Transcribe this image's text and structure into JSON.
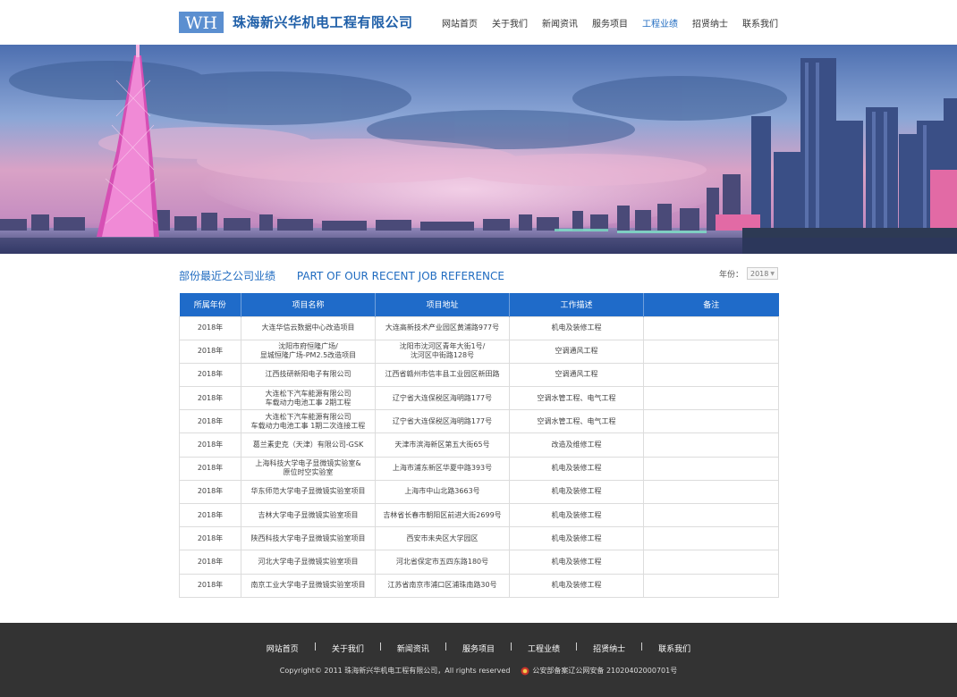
{
  "header": {
    "logo_text": "WH",
    "company_name": "珠海新兴华机电工程有限公司",
    "nav": [
      "网站首页",
      "关于我们",
      "新闻资讯",
      "服务项目",
      "工程业绩",
      "招贤纳士",
      "联系我们"
    ],
    "active_nav": "工程业绩"
  },
  "section": {
    "title_cn": "部份最近之公司业绩",
    "title_en": "PART OF OUR RECENT JOB REFERENCE",
    "year_label": "年份：",
    "year_value": "2018"
  },
  "table": {
    "headers": [
      "所属年份",
      "项目名称",
      "项目地址",
      "工作描述",
      "备注"
    ],
    "rows": [
      [
        "2018年",
        "大连华信云数据中心改造项目",
        "大连高新技术产业园区黄浦路977号",
        "机电及装修工程",
        ""
      ],
      [
        "2018年",
        "沈阳市府恒隆广场/\n显城恒隆广场-PM2.5改造项目",
        "沈阳市沈河区青年大街1号/\n沈河区中街路128号",
        "空调通风工程",
        ""
      ],
      [
        "2018年",
        "江西技研新阳电子有限公司",
        "江西省赣州市信丰县工业园区新田路",
        "空调通风工程",
        ""
      ],
      [
        "2018年",
        "大连松下汽车能源有限公司\n车载动力电池工事 2期工程",
        "辽宁省大连保税区海明路177号",
        "空调水管工程、电气工程",
        ""
      ],
      [
        "2018年",
        "大连松下汽车能源有限公司\n车载动力电池工事 1期二次连接工程",
        "辽宁省大连保税区海明路177号",
        "空调水管工程、电气工程",
        ""
      ],
      [
        "2018年",
        "葛兰素史克（天津）有限公司-GSK",
        "天津市滨海新区第五大街65号",
        "改造及维修工程",
        ""
      ],
      [
        "2018年",
        "上海科技大学电子显微镜实验室&\n原位时空实验室",
        "上海市浦东新区华夏中路393号",
        "机电及装修工程",
        ""
      ],
      [
        "2018年",
        "华东师范大学电子显微镜实验室项目",
        "上海市中山北路3663号",
        "机电及装修工程",
        ""
      ],
      [
        "2018年",
        "吉林大学电子显微镜实验室项目",
        "吉林省长春市朝阳区前进大街2699号",
        "机电及装修工程",
        ""
      ],
      [
        "2018年",
        "陕西科技大学电子显微镜实验室项目",
        "西安市未央区大学园区",
        "机电及装修工程",
        ""
      ],
      [
        "2018年",
        "河北大学电子显微镜实验室项目",
        "河北省保定市五四东路180号",
        "机电及装修工程",
        ""
      ],
      [
        "2018年",
        "南京工业大学电子显微镜实验室项目",
        "江苏省南京市浦口区浦珠南路30号",
        "机电及装修工程",
        ""
      ]
    ]
  },
  "footer": {
    "nav": [
      "网站首页",
      "关于我们",
      "新闻资讯",
      "服务项目",
      "工程业绩",
      "招贤纳士",
      "联系我们"
    ],
    "separator": "|",
    "copyright": "Copyright© 2011 珠海新兴华机电工程有限公司，All rights reserved",
    "police_record": "公安部备案辽公网安备 21020402000701号"
  },
  "colors": {
    "brand_blue": "#1f6bc9",
    "footer_bg": "#333333"
  }
}
